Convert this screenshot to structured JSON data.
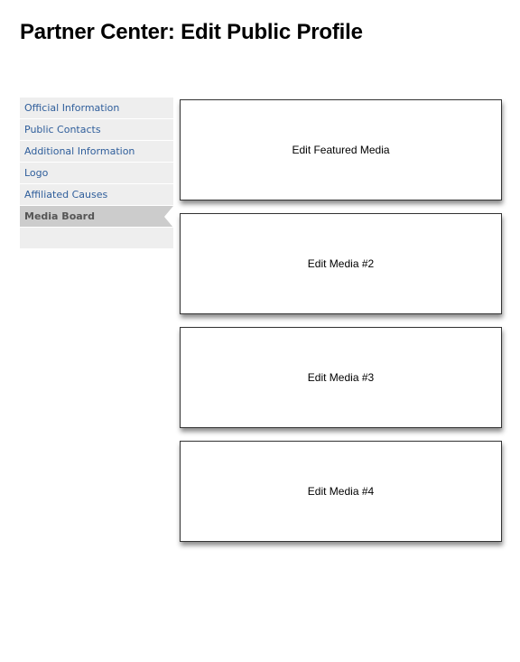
{
  "page": {
    "title": "Partner Center: Edit Public Profile"
  },
  "sidebar": {
    "items": [
      {
        "label": "Official Information",
        "active": false
      },
      {
        "label": "Public Contacts",
        "active": false
      },
      {
        "label": "Additional Information",
        "active": false
      },
      {
        "label": "Logo",
        "active": false
      },
      {
        "label": "Affiliated Causes",
        "active": false
      },
      {
        "label": "Media Board",
        "active": true
      }
    ]
  },
  "media": {
    "boxes": [
      {
        "label": "Edit Featured Media"
      },
      {
        "label": "Edit Media #2"
      },
      {
        "label": "Edit Media #3"
      },
      {
        "label": "Edit Media #4"
      }
    ]
  },
  "colors": {
    "link": "#2f5e9b",
    "sidebar_bg": "#eeeeee",
    "active_bg": "#cccccc",
    "active_text": "#555555"
  }
}
